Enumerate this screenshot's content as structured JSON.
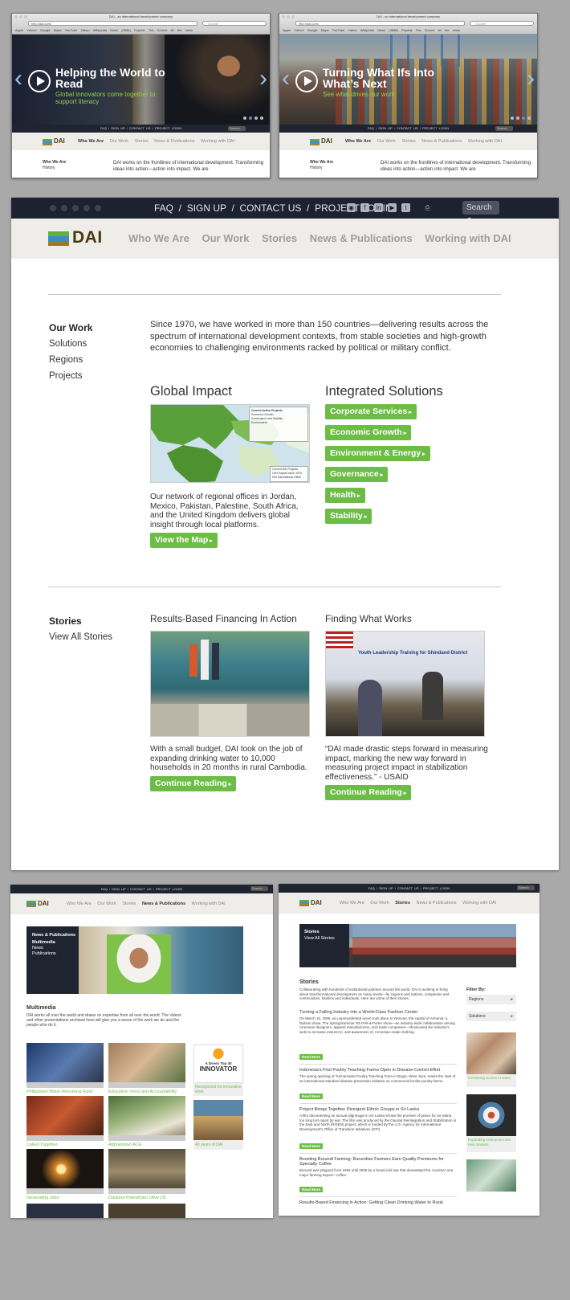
{
  "browser": {
    "title": "DAI - an international development company",
    "url": "http://dai.com/",
    "search_placeholder": "Google",
    "bookmarks": "Apple  Yahoo!  Google Maps  YouTube  Yahoo  Wikipedia  News (3586)  Popular  The Source  All the news"
  },
  "utility": {
    "faq": "FAQ",
    "signup": "SIGN UP",
    "contact": "CONTACT US",
    "login": "PROJECT LOGIN",
    "sep": "/",
    "search": "Search"
  },
  "brand": {
    "name": "DAI"
  },
  "nav": {
    "who": "Who We Are",
    "work": "Our Work",
    "stories": "Stories",
    "news": "News & Publications",
    "working": "Working with DAI"
  },
  "slide1": {
    "headline": "Helping the World to Read",
    "sub": "Global innovators come together to support literacy"
  },
  "slide2": {
    "headline": "Turning What Ifs Into What’s Next",
    "sub": "See what drives our work"
  },
  "mini_body": {
    "who": "Who We Are",
    "history": "History",
    "text": "DAI works on the frontlines of international development. Transforming ideas into action—action into impact. We are"
  },
  "work": {
    "side_title": "Our Work",
    "side_items": [
      "Solutions",
      "Regions",
      "Projects"
    ],
    "intro": "Since 1970, we have worked in more than 150 countries—delivering results across the spectrum of international development contexts, from stable societies and high-growth economies to challenging environments racked by political or military conflict.",
    "impact_title": "Global Impact",
    "map_legend_title": "Current Active Projects",
    "map_legend": [
      "Economic Growth",
      "Governance and Stability",
      "Environment"
    ],
    "map_key": [
      "Current DAI Projects",
      "Old Projects since 1970",
      "DAI International Office"
    ],
    "impact_text": "Our network of regional offices in Jordan, Mexico, Pakistan, Palestine, South Africa, and the United Kingdom delivers global insight through local platforms.",
    "map_button": "View the Map",
    "solutions_title": "Integrated Solutions",
    "solutions": [
      "Corporate Services",
      "Economic Growth",
      "Environment & Energy",
      "Governance",
      "Health",
      "Stability"
    ]
  },
  "stories": {
    "side_title": "Stories",
    "side_link": "View All Stories",
    "s1_title": "Results-Based Financing In Action",
    "s1_text": "With a small budget, DAI took on the job of expanding drinking water to 10,000 households in 20 months in rural Cambodia.",
    "s2_title": "Finding What Works",
    "s2_banner": "Youth Leadership Training for Shindand District",
    "s2_text": "“DAI made drastic steps forward in measuring impact, marking the new way forward in measuring project impact in stabilization effectiveness.” - USAID",
    "cta": "Continue Reading"
  },
  "multimedia": {
    "side": [
      "News & Publications",
      "Multimedia",
      "News",
      "Publications"
    ],
    "title": "Multimedia",
    "intro": "DAI works all over the world and draws on expertise from all over the world. The videos and other presentations archived here will give you a sense of the work we do and the people who do it.",
    "videos": [
      "Philippines Water Revolving Fund",
      "Education Voice and Accountability",
      "Called Together",
      "Afghanistan ACE",
      "Generating Jobs",
      "Daskara Palestinian Olive Oil"
    ],
    "devex": "A Devex Top 40",
    "innovator": "INNOVATOR",
    "devex_caption": "Recognized for innovative work",
    "years_caption": "40 years of DAI"
  },
  "stories_page": {
    "side": [
      "Stories",
      "View All Stories"
    ],
    "title": "Stories",
    "intro": "Collaborating with hundreds of institutional partners around the world, DAI is working to bring about transformational development on many levels—for regions and nations, companies and communities, families and individuals. Here are some of their stories.",
    "items": [
      {
        "title": "Turning a Falling Industry into a World-Class Fashion Center",
        "text": "On March 16, 2005, an unprecedented event took place in Yerevan, the capital of Armenia: a fashion show. The Spring/Summer '05 Prêt-à-Porter show—an industry-wide collaboration among Armenian designers, apparel manufacturers, and trade companies—showcased the industry's work to increase interest in, and awareness of, Armenian-made clothing."
      },
      {
        "title": "Indonesia's First Poultry Teaching Farms Open in Disease-Control Effort",
        "text": "The spring opening of Turinamaeta Poultry Teaching Farm in Bogor, West Java, marks the start of an international-standard disease prevention initiative on commercial broiler-poultry farms."
      },
      {
        "title": "Project Brings Together Divergent Ethnic Groups in Sri Lanka",
        "text": "A film documenting an annual pilgrimage in Sri Lanka shows the promise of peace for an island too long torn apart by war. The film was produced by the Gaurad Reintegration and Stabilization in the East and North (RISEN) project, which is funded by the U.S. Agency for International Development's Office of Transition Initiatives (OTI)."
      },
      {
        "title": "Boosting Burundi Farming: Burundian Farmers Earn Quality Premiums for Specialty Coffee",
        "text": "Burundi was plagued from 1994 until 2005 by a brutal civil war that devastated the country's one major farming export—coffee."
      },
      {
        "title": "Results-Based Financing in Action: Getting Clean Drinking Water to Rural",
        "text": ""
      }
    ],
    "read_more": "Read More",
    "filter": "Filter By:",
    "filters": [
      "Regions",
      "Solutions"
    ],
    "captions": [
      "Increasing access to water",
      "Expanding enterprises into new markets"
    ]
  }
}
